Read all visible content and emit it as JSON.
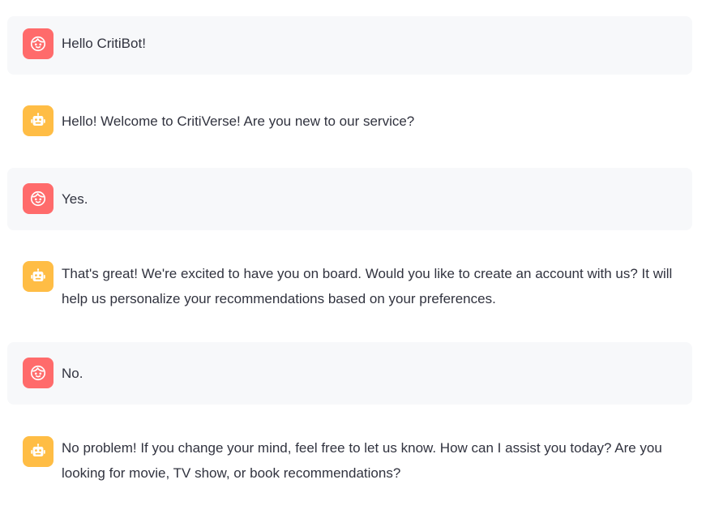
{
  "colors": {
    "user_avatar": "#ff6b6b",
    "assistant_avatar": "#ffbd45",
    "user_bubble_bg": "#f7f8fa",
    "text": "#31333f"
  },
  "messages": [
    {
      "role": "user",
      "avatar_icon": "face-icon",
      "text": "Hello CritiBot!"
    },
    {
      "role": "assistant",
      "avatar_icon": "robot-icon",
      "text": "Hello! Welcome to CritiVerse! Are you new to our service?"
    },
    {
      "role": "user",
      "avatar_icon": "face-icon",
      "text": "Yes."
    },
    {
      "role": "assistant",
      "avatar_icon": "robot-icon",
      "text": "That's great! We're excited to have you on board. Would you like to create an account with us? It will help us personalize your recommendations based on your preferences."
    },
    {
      "role": "user",
      "avatar_icon": "face-icon",
      "text": "No."
    },
    {
      "role": "assistant",
      "avatar_icon": "robot-icon",
      "text": "No problem! If you change your mind, feel free to let us know. How can I assist you today? Are you looking for movie, TV show, or book recommendations?"
    }
  ]
}
